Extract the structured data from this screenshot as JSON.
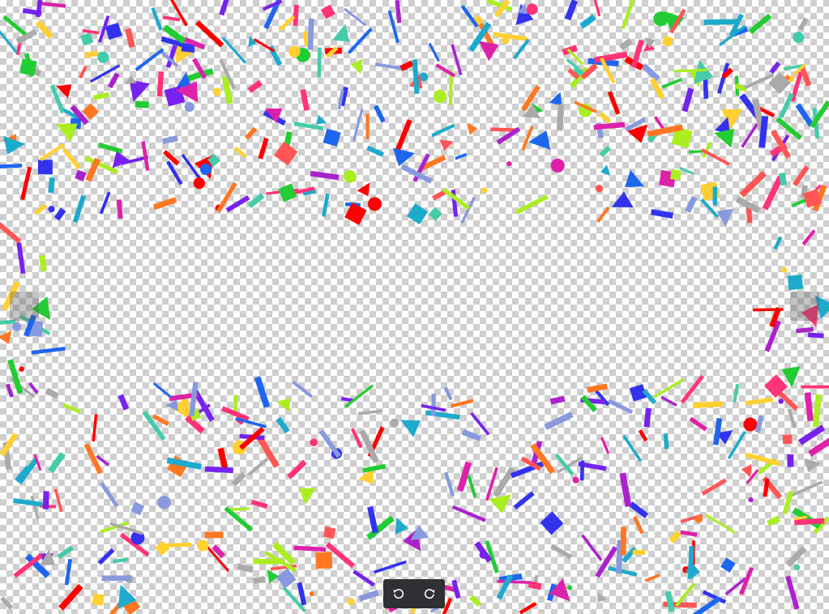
{
  "viewer": {
    "image_content": "confetti-transparent-background",
    "confetti_colors": [
      "#ff0000",
      "#ff7722",
      "#ffd030",
      "#aaee22",
      "#22cc33",
      "#1eaacc",
      "#1e66ee",
      "#3333ee",
      "#7722ee",
      "#aa22cc",
      "#dd22aa",
      "#ff3377",
      "#ff5555",
      "#44ccaa",
      "#8899dd",
      "#aaaaaa"
    ]
  },
  "navigation": {
    "prev_icon": "chevron-left-icon",
    "next_icon": "chevron-right-icon"
  },
  "toolbar": {
    "rotate_left_icon": "rotate-left-icon",
    "rotate_right_icon": "rotate-right-icon"
  }
}
